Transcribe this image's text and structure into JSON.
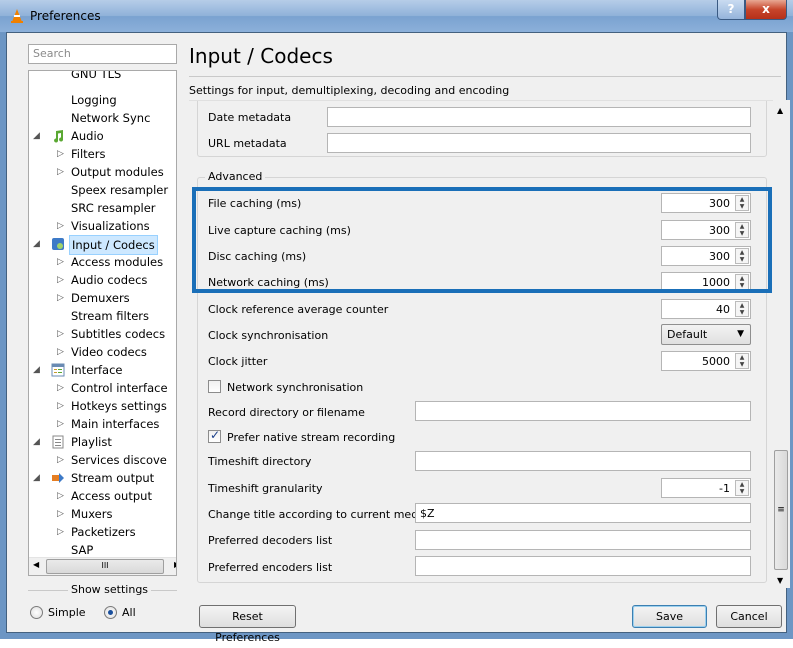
{
  "window": {
    "title": "Preferences",
    "help": "?",
    "close": "x"
  },
  "search": {
    "placeholder": "Search"
  },
  "tree": {
    "items": [
      {
        "label": "GNU TLS"
      },
      {
        "label": "Logging"
      },
      {
        "label": "Network Sync"
      },
      {
        "label": "Audio"
      },
      {
        "label": "Filters"
      },
      {
        "label": "Output modules"
      },
      {
        "label": "Speex resampler"
      },
      {
        "label": "SRC resampler"
      },
      {
        "label": "Visualizations"
      },
      {
        "label": "Input / Codecs"
      },
      {
        "label": "Access modules"
      },
      {
        "label": "Audio codecs"
      },
      {
        "label": "Demuxers"
      },
      {
        "label": "Stream filters"
      },
      {
        "label": "Subtitles codecs"
      },
      {
        "label": "Video codecs"
      },
      {
        "label": "Interface"
      },
      {
        "label": "Control interface"
      },
      {
        "label": "Hotkeys settings"
      },
      {
        "label": "Main interfaces"
      },
      {
        "label": "Playlist"
      },
      {
        "label": "Services discove"
      },
      {
        "label": "Stream output"
      },
      {
        "label": "Access output"
      },
      {
        "label": "Muxers"
      },
      {
        "label": "Packetizers"
      },
      {
        "label": "SAP"
      }
    ],
    "hscroll_glyph": "III"
  },
  "show_settings": {
    "label": "Show settings",
    "simple": "Simple",
    "all": "All"
  },
  "page": {
    "title": "Input / Codecs",
    "subtitle": "Settings for input, demultiplexing, decoding and encoding"
  },
  "fields": {
    "date_metadata": "Date metadata",
    "url_metadata": "URL metadata",
    "advanced": "Advanced",
    "file_caching": {
      "label": "File caching (ms)",
      "value": "300"
    },
    "live_caching": {
      "label": "Live capture caching (ms)",
      "value": "300"
    },
    "disc_caching": {
      "label": "Disc caching (ms)",
      "value": "300"
    },
    "network_caching": {
      "label": "Network caching (ms)",
      "value": "1000"
    },
    "clock_ref": {
      "label": "Clock reference average counter",
      "value": "40"
    },
    "clock_sync": {
      "label": "Clock synchronisation",
      "value": "Default"
    },
    "clock_jitter": {
      "label": "Clock jitter",
      "value": "5000"
    },
    "network_sync": {
      "label": "Network synchronisation",
      "checked": false
    },
    "record_dir": {
      "label": "Record directory or filename",
      "value": ""
    },
    "prefer_native": {
      "label": "Prefer native stream recording",
      "checked": true
    },
    "timeshift_dir": {
      "label": "Timeshift directory",
      "value": ""
    },
    "timeshift_gran": {
      "label": "Timeshift granularity",
      "value": "-1"
    },
    "change_title": {
      "label": "Change title according to current media",
      "value": "$Z"
    },
    "pref_decoders": {
      "label": "Preferred decoders list",
      "value": ""
    },
    "pref_encoders": {
      "label": "Preferred encoders list",
      "value": ""
    }
  },
  "buttons": {
    "reset": "Reset Preferences",
    "save": "Save",
    "cancel": "Cancel"
  },
  "colors": {
    "highlight": "#1a6fb8",
    "selection": "#cde8ff"
  }
}
